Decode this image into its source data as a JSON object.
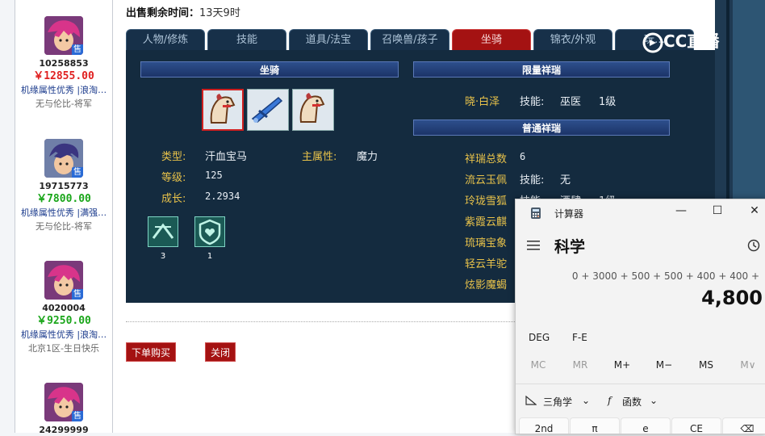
{
  "sidebar": {
    "sellers": [
      {
        "id": "10258853",
        "price": "￥12855.00",
        "price_color": "red",
        "desc": "机缘属性优秀 |浪淘…",
        "server": "无与伦比-将军",
        "tag": "售"
      },
      {
        "id": "19715773",
        "price": "￥7800.00",
        "price_color": "green",
        "desc": "机缘属性优秀 |满强…",
        "server": "无与伦比-将军",
        "tag": "售"
      },
      {
        "id": "4020004",
        "price": "￥9250.00",
        "price_color": "green",
        "desc": "机缘属性优秀 |浪淘…",
        "server": "北京1区-生日快乐",
        "tag": "售"
      },
      {
        "id": "24299999",
        "price": "",
        "price_color": "green",
        "desc": "",
        "server": "",
        "tag": "售"
      }
    ]
  },
  "header": {
    "remaining_label": "出售剩余时间：",
    "remaining_value": "13天9时"
  },
  "tabs": [
    {
      "label": "人物/修炼",
      "active": false
    },
    {
      "label": "技能",
      "active": false
    },
    {
      "label": "道具/法宝",
      "active": false
    },
    {
      "label": "召唤兽/孩子",
      "active": false
    },
    {
      "label": "坐骑",
      "active": true
    },
    {
      "label": "锦衣/外观",
      "active": false
    },
    {
      "label": "玩…",
      "active": false
    }
  ],
  "mount_panel": {
    "section_title": "坐骑",
    "slots": [
      "horse-icon",
      "flying-sword-icon",
      "horse-icon"
    ],
    "type_label": "类型:",
    "type_value": "汗血宝马",
    "main_attr_label": "主属性:",
    "main_attr_value": "魔力",
    "level_label": "等级:",
    "level_value": "125",
    "growth_label": "成长:",
    "growth_value": "2.2934",
    "skills": [
      {
        "icon": "mount-skill-icon",
        "count": "3"
      },
      {
        "icon": "heart-shield-icon",
        "count": "1"
      }
    ]
  },
  "limited_panel": {
    "title": "限量祥瑞",
    "item_name": "晓·白泽",
    "skill_label": "技能:",
    "skill_name": "巫医",
    "skill_level": "1级"
  },
  "normal_panel": {
    "title": "普通祥瑞",
    "total_label": "祥瑞总数",
    "total_value": "6",
    "items": [
      {
        "name": "流云玉佩",
        "skill_label": "技能:",
        "skill_value": "无"
      },
      {
        "name": "玲珑雪狐",
        "skill_label": "技能:",
        "skill_value": "酒肆",
        "level": "1级"
      },
      {
        "name": "紫霞云麒"
      },
      {
        "name": "琉璃宝象"
      },
      {
        "name": "轻云羊驼"
      },
      {
        "name": "炫影魔蝎"
      }
    ]
  },
  "actions": {
    "buy_label": "下单购买",
    "close_label": "关闭"
  },
  "watermark": "CC直播",
  "calculator": {
    "title": "计算器",
    "mode": "科学",
    "expression": "0 + 3000 + 500 + 500 + 400 + 400 +",
    "result": "4,800",
    "fn_row": [
      "DEG",
      "F-E"
    ],
    "memory_row": [
      "MC",
      "MR",
      "M+",
      "M−",
      "MS",
      "M∨"
    ],
    "trig_label": "三角学",
    "func_label": "函数",
    "keys": [
      "2nd",
      "π",
      "e",
      "CE",
      "⌫"
    ]
  },
  "colors": {
    "panel_bg": "#142b3f",
    "active_tab": "#a41212",
    "gold_text": "#e8c24a"
  }
}
